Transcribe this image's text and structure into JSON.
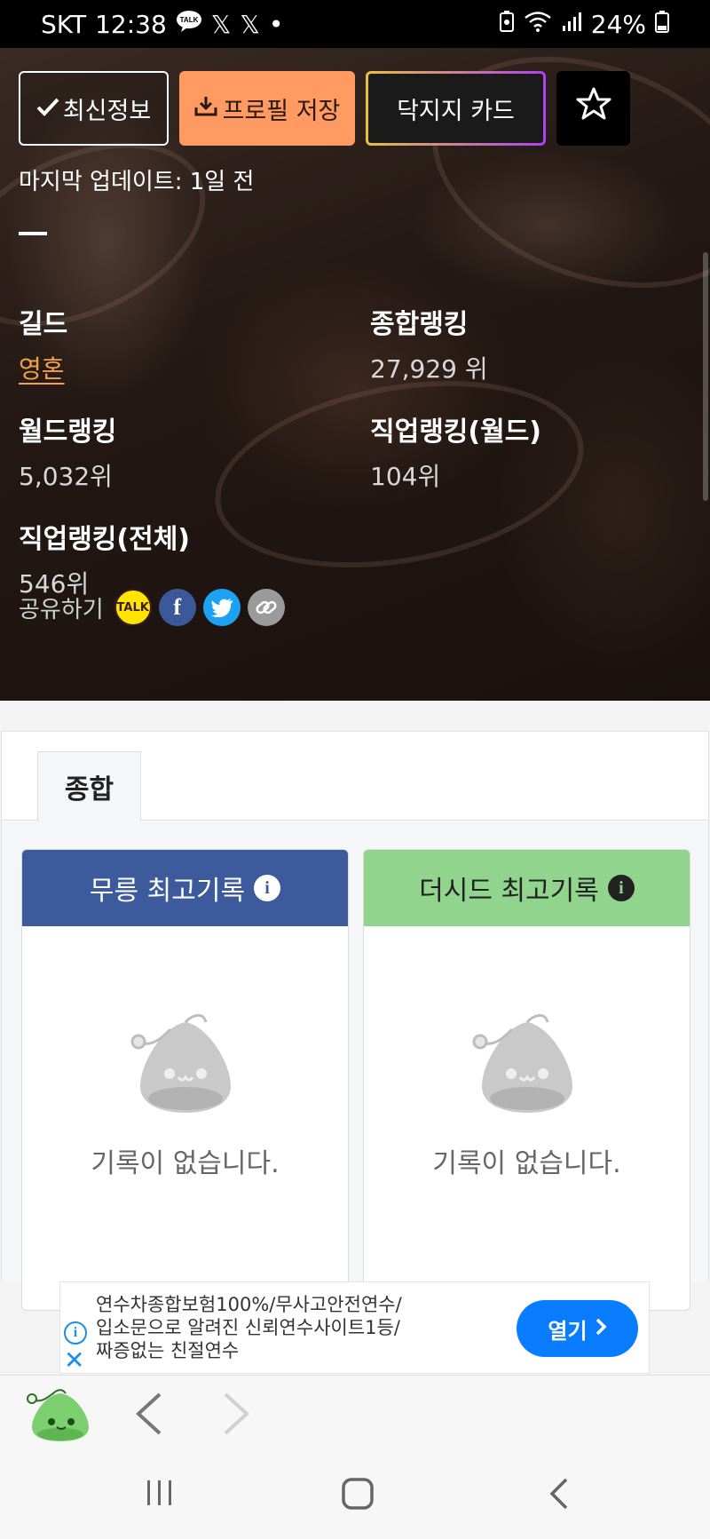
{
  "status_bar": {
    "carrier": "SKT",
    "time": "12:38",
    "talk_badge": "TALK",
    "x_icon_1": "𝕏",
    "x_icon_2": "𝕏",
    "dot": "•",
    "battery": "24%"
  },
  "actions": {
    "refresh_label": "최신정보",
    "save_profile_label": "프로필 저장",
    "dakjiji_card_label": "닥지지 카드",
    "favorite_icon": "star-icon"
  },
  "last_updated": "마지막 업데이트: 1일 전",
  "stats": {
    "guild": {
      "label": "길드",
      "value": "영혼"
    },
    "overall_rank": {
      "label": "종합랭킹",
      "value": "27,929 위"
    },
    "world_rank": {
      "label": "월드랭킹",
      "value": "5,032위"
    },
    "job_rank_world": {
      "label": "직업랭킹(월드)",
      "value": "104위"
    },
    "job_rank_all": {
      "label": "직업랭킹(전체)",
      "value": "546위"
    }
  },
  "share": {
    "label": "공유하기",
    "kakao": "TALK",
    "facebook": "f"
  },
  "tabs": [
    {
      "label": "종합",
      "active": true
    }
  ],
  "records": {
    "mureung": {
      "title": "무릉 최고기록",
      "empty": "기록이 없습니다.",
      "color": "#3d5a9c"
    },
    "theseed": {
      "title": "더시드 최고기록",
      "empty": "기록이 없습니다.",
      "color": "#90d48e"
    }
  },
  "ad": {
    "text_line1": "연수차종합보험100%/무사고안전연수/",
    "text_line2": "입소문으로 알려진 신뢰연수사이트1등/",
    "text_line3": "짜증없는 친절연수",
    "open_label": "열기",
    "accent": "#0a7cff"
  },
  "colors": {
    "save_button": "#ff9a62",
    "guild_link": "#f4a04a"
  }
}
